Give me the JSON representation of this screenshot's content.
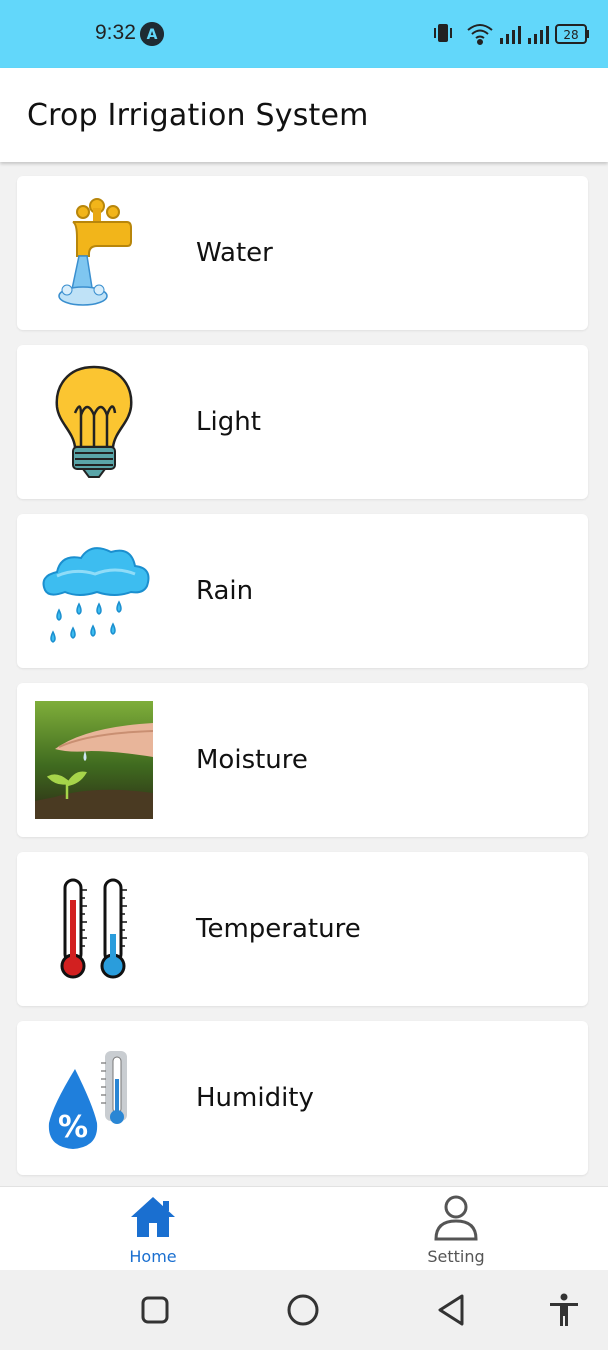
{
  "status_bar": {
    "time": "9:32",
    "notification_letter": "A",
    "battery": "28",
    "background": "#62d7fa"
  },
  "app_bar": {
    "title": "Crop Irrigation System"
  },
  "cards": [
    {
      "label": "Water",
      "icon": "faucet-icon"
    },
    {
      "label": "Light",
      "icon": "light-bulb-icon"
    },
    {
      "label": "Rain",
      "icon": "rain-cloud-icon"
    },
    {
      "label": "Moisture",
      "icon": "moisture-photo"
    },
    {
      "label": "Temperature",
      "icon": "thermometer-icon"
    },
    {
      "label": "Humidity",
      "icon": "humidity-icon"
    }
  ],
  "bottom_nav": {
    "home_label": "Home",
    "setting_label": "Setting",
    "active_color": "#1a6fd0",
    "inactive_color": "#555555"
  }
}
